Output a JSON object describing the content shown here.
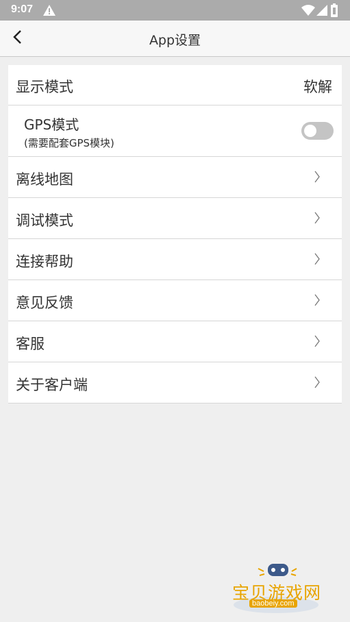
{
  "status_bar": {
    "time": "9:07",
    "icons": [
      "warning-icon",
      "wifi-icon",
      "signal-icon",
      "battery-icon"
    ]
  },
  "header": {
    "title": "App设置",
    "back_icon": "chevron-left-icon"
  },
  "settings": {
    "display_mode": {
      "label": "显示模式",
      "value": "软解"
    },
    "gps": {
      "label": "GPS模式",
      "sub_label": "(需要配套GPS模块)",
      "enabled": false
    },
    "items": [
      {
        "label": "离线地图"
      },
      {
        "label": "调试模式"
      },
      {
        "label": "连接帮助"
      },
      {
        "label": "意见反馈"
      },
      {
        "label": "客服"
      },
      {
        "label": "关于客户端"
      }
    ]
  },
  "watermark": {
    "text": "宝贝游戏网",
    "url": "baobeiy.com"
  },
  "colors": {
    "background": "#efefef",
    "status_bar": "#ababab",
    "toggle_off": "#c4c4c4",
    "watermark": "#e8a400"
  }
}
